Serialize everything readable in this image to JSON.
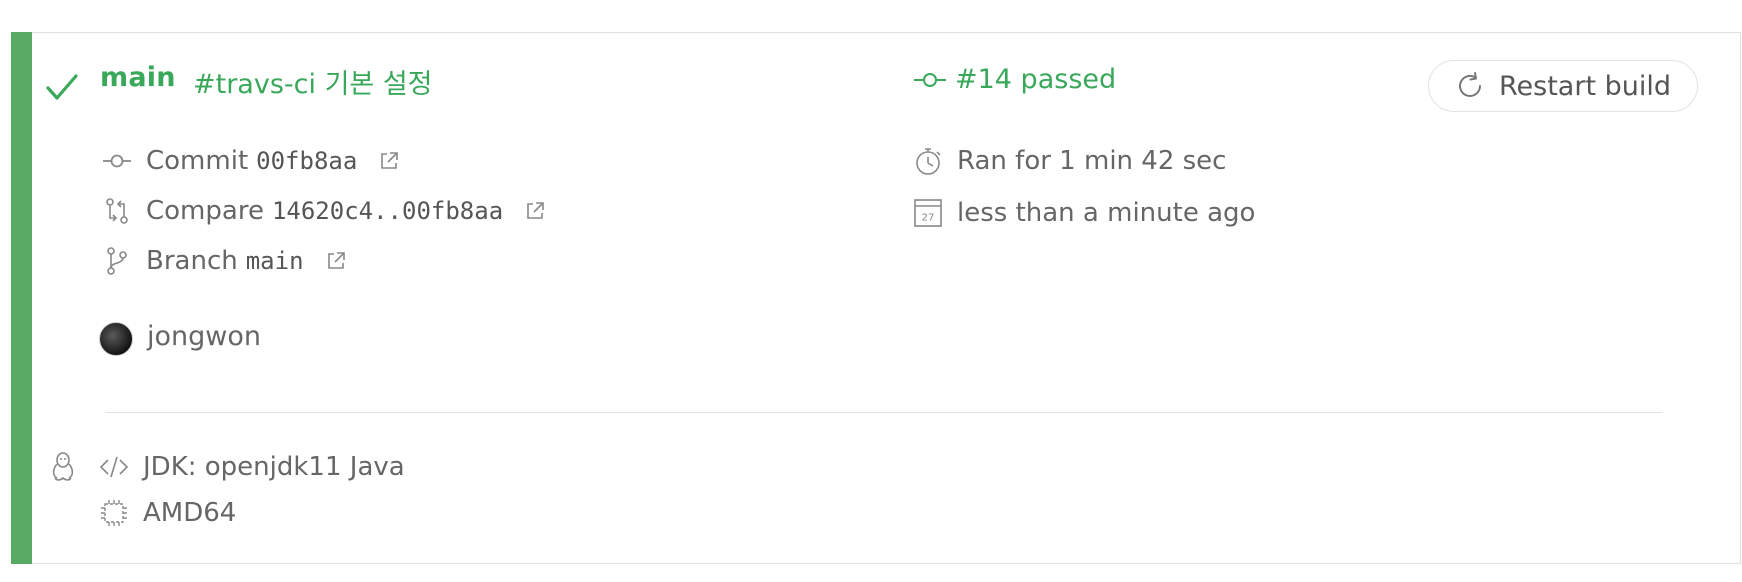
{
  "build": {
    "branch": "main",
    "commit_message": "#travs-ci 기본 설정",
    "status_text": "#14 passed",
    "restart_label": "Restart build"
  },
  "commit": {
    "label": "Commit",
    "hash": "00fb8aa"
  },
  "compare": {
    "label": "Compare",
    "range": "14620c4..00fb8aa"
  },
  "branch_row": {
    "label": "Branch",
    "name": "main"
  },
  "duration": {
    "text": "Ran for 1 min 42 sec"
  },
  "finished": {
    "text": "less than a minute ago",
    "calendar_day": "27"
  },
  "author": {
    "name": "jongwon"
  },
  "job": {
    "os_icon": "linux-tux-icon",
    "language": "JDK: openjdk11 Java",
    "arch": "AMD64"
  },
  "colors": {
    "status_green": "#39a85b",
    "status_bar": "#58a964",
    "text_gray": "#666666"
  }
}
